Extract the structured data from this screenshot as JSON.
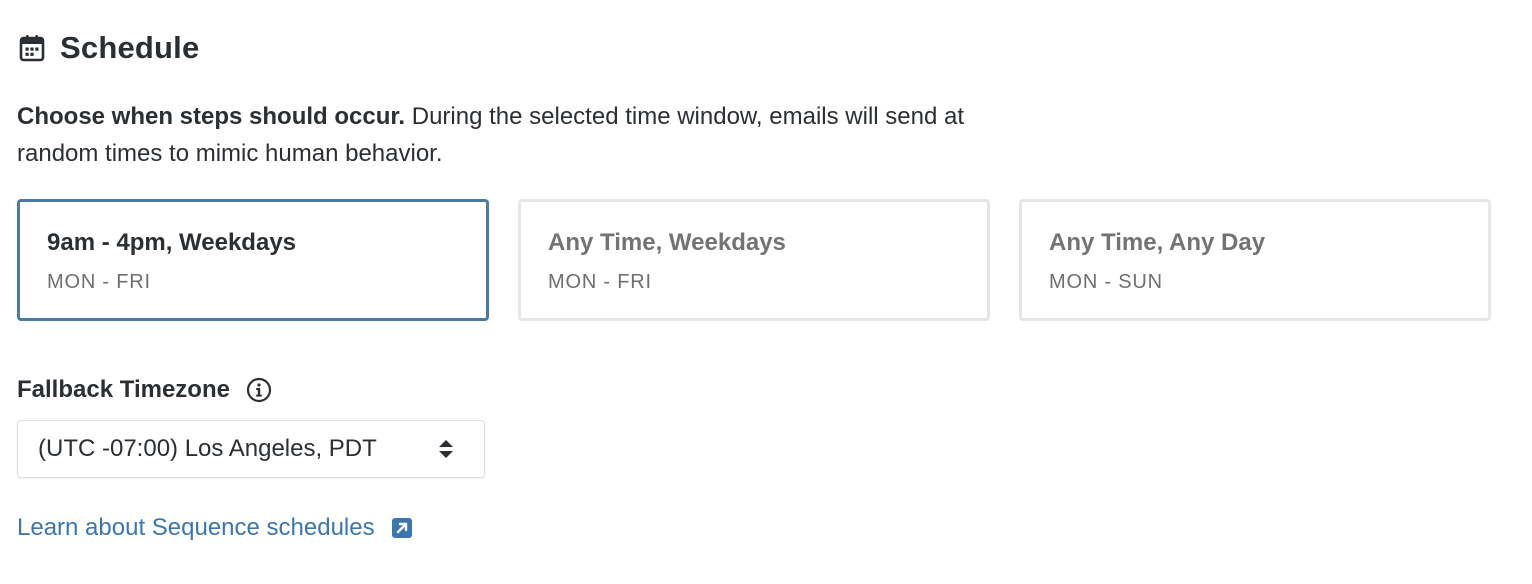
{
  "header": {
    "icon": "calendar-icon",
    "title": "Schedule"
  },
  "description": {
    "bold": "Choose when steps should occur.",
    "text": " During the selected time window, emails will send at random times to mimic human behavior."
  },
  "options": [
    {
      "title": "9am - 4pm, Weekdays",
      "subtitle": "MON - FRI",
      "selected": true
    },
    {
      "title": "Any Time, Weekdays",
      "subtitle": "MON - FRI",
      "selected": false
    },
    {
      "title": "Any Time, Any Day",
      "subtitle": "MON - SUN",
      "selected": false
    }
  ],
  "timezone": {
    "label": "Fallback Timezone",
    "info_icon": "info-icon",
    "selected_value": "(UTC -07:00) Los Angeles, PDT",
    "arrows_icon": "sort-arrows-icon"
  },
  "learn_link": {
    "text": "Learn about Sequence schedules",
    "icon": "external-link-icon"
  },
  "colors": {
    "text": "#2b2f33",
    "muted": "#737373",
    "selected_border": "#4a7aa8",
    "border": "#e4e6e8",
    "link": "#3c76ad"
  }
}
